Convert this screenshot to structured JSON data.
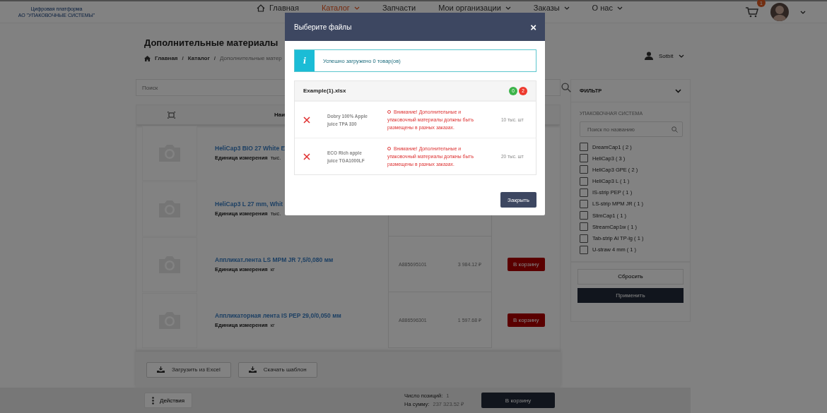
{
  "logo": {
    "line1": "Цифровая платформа",
    "line2": "АО \"УПАКОВОЧНЫЕ СИСТЕМЫ\""
  },
  "nav": [
    {
      "label": "Главная",
      "kind": "home",
      "selected": false,
      "caret": false
    },
    {
      "label": "Каталог",
      "kind": "plain",
      "selected": true,
      "caret": true
    },
    {
      "label": "Запчасти",
      "kind": "plain",
      "selected": false,
      "caret": false
    },
    {
      "label": "Мои организации",
      "kind": "plain",
      "selected": false,
      "caret": true
    },
    {
      "label": "Заказы",
      "kind": "plain",
      "selected": false,
      "caret": true
    },
    {
      "label": "О нас",
      "kind": "plain",
      "selected": false,
      "caret": true
    }
  ],
  "cart": {
    "count": "1"
  },
  "page_title": "Дополнительные материалы",
  "breadcrumbs": [
    "Главная",
    "Каталог",
    "Дополнительные матер"
  ],
  "breadcrumb_separator": "/",
  "user": {
    "name": "Sotbit"
  },
  "search": {
    "placeholder": "Поиск"
  },
  "table": {
    "columns": [
      "Наи"
    ],
    "rows": [
      {
        "name": "HeliCap3 BIO 27 White E",
        "unit_label": "Единица измерения",
        "unit": "тыс."
      },
      {
        "name": "HeliCap3 L 27 mm, Whit",
        "unit_label": "Единица измерения",
        "unit": "тыс."
      },
      {
        "name": "Аппликат.лента LS MPM JR 7,5/0,080 мм",
        "unit_label": "Единица измерения",
        "unit": "кг",
        "article": "A885695101",
        "price": "3 984.12 ₽",
        "button": "В корзину"
      },
      {
        "name": "Аппликаторная лента IS PEP 29,0/0,050 мм",
        "unit_label": "Единица измерения",
        "unit": "кг",
        "article": "A886596301",
        "price": "1 597.68 ₽",
        "button": "В корзину"
      }
    ]
  },
  "tools": [
    "Загрузить из Excel",
    "Скачать шаблон"
  ],
  "footer": {
    "actions": "Действия",
    "count_label": "Число позиций:",
    "count": "1",
    "sum_label": "На сумму:",
    "sum": "237 323.52 ₽",
    "button": "В корзину"
  },
  "filter": {
    "title": "ФИЛЬТР",
    "section": "УПАКОВОЧНАЯ СИСТЕМА",
    "placeholder": "Поиск по названию",
    "items": [
      {
        "label": "DreamCap1 ( 2 )",
        "checked": false
      },
      {
        "label": "HeliCap3 ( 3 )",
        "checked": false
      },
      {
        "label": "HeliCap3 GPE ( 2 )",
        "checked": false
      },
      {
        "label": "HeliCap3 L ( 1 )",
        "checked": false
      },
      {
        "label": "IS-strip PEP ( 1 )",
        "checked": false
      },
      {
        "label": "LS-strip MPM JR ( 1 )",
        "checked": false
      },
      {
        "label": "SlimCap1 ( 1 )",
        "checked": false
      },
      {
        "label": "StreamCap1w ( 1 )",
        "checked": false
      },
      {
        "label": "Tab-strip Al TP-lg ( 1 )",
        "checked": false
      },
      {
        "label": "U-straw 4 mm ( 1 )",
        "checked": false
      }
    ],
    "reset": "Сбросить",
    "apply": "Применить"
  },
  "modal": {
    "title": "Выберите файлы",
    "close": "×",
    "alert_icon": "i",
    "alert": "Успешно загружено 0 товар(ов)",
    "file": {
      "name": "Example(1).xlsx",
      "ok_count": "0",
      "error_count": "2",
      "rows": [
        {
          "name": "Dobry 100% Apple juice TPA 330",
          "message": "Внимание! Дополнительные и упаковочный материалы должны быть размещены в разных заказах.",
          "qty": "10 тыс. шт"
        },
        {
          "name": "ECO Rich apple juice TGA1000LF",
          "message": "Внимание! Дополнительные и упаковочный материалы должны быть размещены в разных заказах.",
          "qty": "20 тыс. шт"
        }
      ]
    },
    "button": "Закрыть"
  }
}
